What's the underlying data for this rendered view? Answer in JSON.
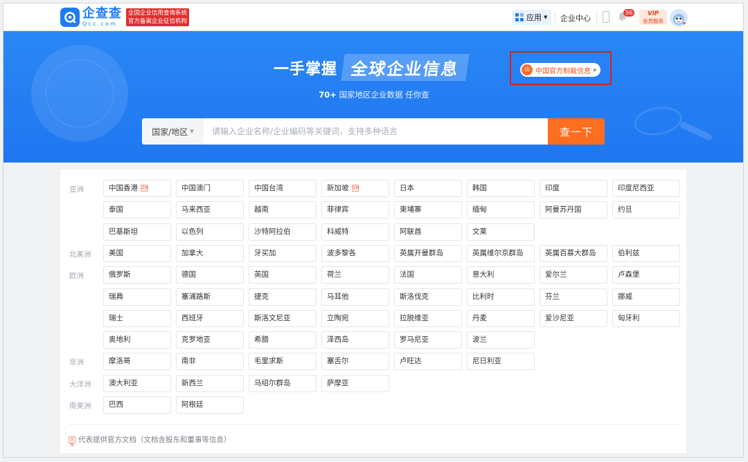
{
  "header": {
    "logo_cn": "企查查",
    "logo_en": "Qcc.com",
    "badge_line1": "全国企业信用查询系统",
    "badge_line2": "官方备案企业征信机构",
    "apps_label": "应用",
    "enterprise_label": "企业中心",
    "notification_count": "56",
    "vip_label": "VIP",
    "vip_sub": "会员服务"
  },
  "hero": {
    "title_left": "一手掌握",
    "title_right": "全球企业信息",
    "subtitle_num": "70+",
    "subtitle_rest": "国家地区企业数据 任你查",
    "sanction_label": "中国官方制裁信息"
  },
  "search": {
    "region_label": "国家/地区",
    "placeholder": "请输入企业名称/企业编码等关键词，支持多种语言",
    "button_label": "查一下"
  },
  "regions": [
    {
      "name": "亚洲",
      "countries": [
        {
          "n": "中国香港",
          "doc": true
        },
        {
          "n": "中国澳门"
        },
        {
          "n": "中国台湾"
        },
        {
          "n": "新加坡",
          "doc": true
        },
        {
          "n": "日本"
        },
        {
          "n": "韩国"
        },
        {
          "n": "印度"
        },
        {
          "n": "印度尼西亚"
        },
        {
          "n": "泰国"
        },
        {
          "n": "马来西亚"
        },
        {
          "n": "越南"
        },
        {
          "n": "菲律宾"
        },
        {
          "n": "柬埔寨"
        },
        {
          "n": "缅甸"
        },
        {
          "n": "阿曼苏丹国"
        },
        {
          "n": "约旦"
        },
        {
          "n": "巴基斯坦"
        },
        {
          "n": "以色列"
        },
        {
          "n": "沙特阿拉伯"
        },
        {
          "n": "科威特"
        },
        {
          "n": "阿联酋"
        },
        {
          "n": "文莱"
        }
      ]
    },
    {
      "name": "北美洲",
      "countries": [
        {
          "n": "美国"
        },
        {
          "n": "加拿大"
        },
        {
          "n": "牙买加"
        },
        {
          "n": "波多黎各"
        },
        {
          "n": "英属开曼群岛"
        },
        {
          "n": "英属维尔京群岛"
        },
        {
          "n": "英属百慕大群岛"
        },
        {
          "n": "伯利兹"
        }
      ]
    },
    {
      "name": "欧洲",
      "countries": [
        {
          "n": "俄罗斯"
        },
        {
          "n": "德国"
        },
        {
          "n": "英国"
        },
        {
          "n": "荷兰"
        },
        {
          "n": "法国"
        },
        {
          "n": "意大利"
        },
        {
          "n": "爱尔兰"
        },
        {
          "n": "卢森堡"
        },
        {
          "n": "瑞典"
        },
        {
          "n": "塞浦路斯"
        },
        {
          "n": "捷克"
        },
        {
          "n": "马耳他"
        },
        {
          "n": "斯洛伐克"
        },
        {
          "n": "比利时"
        },
        {
          "n": "芬兰"
        },
        {
          "n": "挪威"
        },
        {
          "n": "瑞士"
        },
        {
          "n": "西班牙"
        },
        {
          "n": "斯洛文尼亚"
        },
        {
          "n": "立陶宛"
        },
        {
          "n": "拉脱维亚"
        },
        {
          "n": "丹麦"
        },
        {
          "n": "爱沙尼亚"
        },
        {
          "n": "匈牙利"
        },
        {
          "n": "奥地利"
        },
        {
          "n": "克罗地亚"
        },
        {
          "n": "希腊"
        },
        {
          "n": "泽西岛"
        },
        {
          "n": "罗马尼亚"
        },
        {
          "n": "波兰"
        }
      ]
    },
    {
      "name": "非洲",
      "countries": [
        {
          "n": "摩洛哥"
        },
        {
          "n": "南非"
        },
        {
          "n": "毛里求斯"
        },
        {
          "n": "塞舌尔"
        },
        {
          "n": "卢旺达"
        },
        {
          "n": "尼日利亚"
        }
      ]
    },
    {
      "name": "大洋洲",
      "countries": [
        {
          "n": "澳大利亚"
        },
        {
          "n": "新西兰"
        },
        {
          "n": "马绍尔群岛"
        },
        {
          "n": "萨摩亚"
        }
      ]
    },
    {
      "name": "南美洲",
      "countries": [
        {
          "n": "巴西"
        },
        {
          "n": "阿根廷"
        }
      ]
    }
  ],
  "doc_mark_label": "文档",
  "footnote": "代表提供官方文档（文档含股东和董事等信息）"
}
